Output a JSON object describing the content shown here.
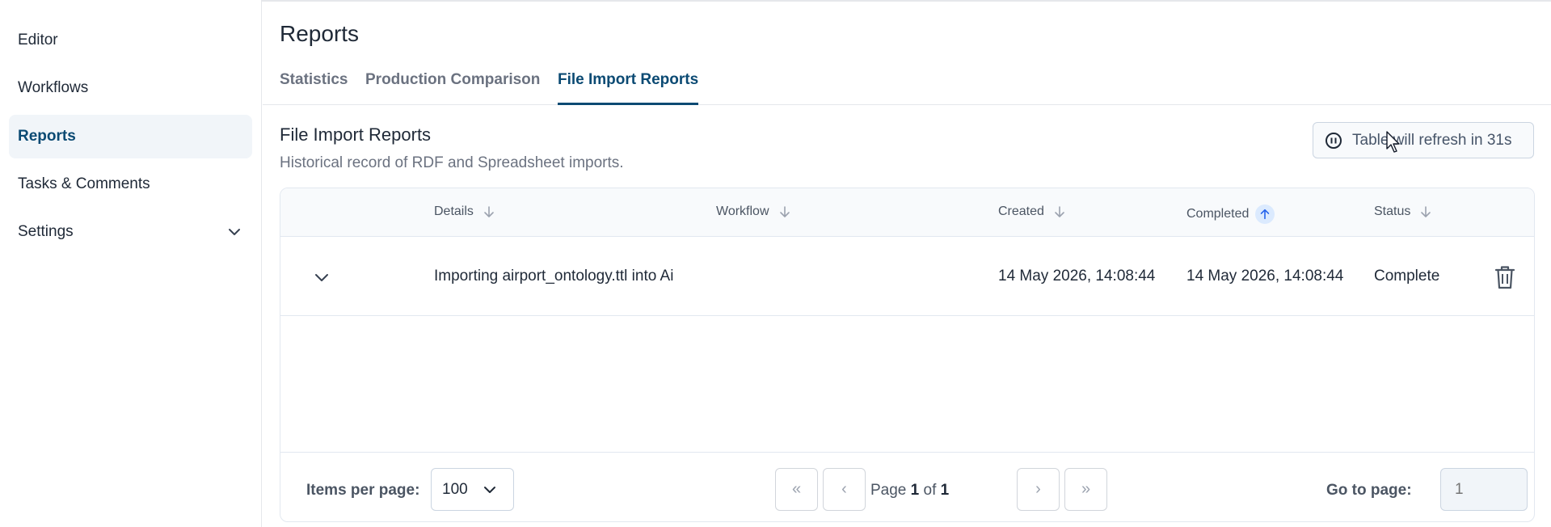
{
  "sidebar": {
    "items": [
      {
        "label": "Editor"
      },
      {
        "label": "Workflows"
      },
      {
        "label": "Reports"
      },
      {
        "label": "Tasks & Comments"
      },
      {
        "label": "Settings"
      }
    ]
  },
  "header": {
    "title": "Reports"
  },
  "tabs": [
    {
      "label": "Statistics"
    },
    {
      "label": "Production Comparison"
    },
    {
      "label": "File Import Reports"
    }
  ],
  "section": {
    "title": "File Import Reports",
    "subtitle": "Historical record of RDF and Spreadsheet imports.",
    "refresh_label": "Table will refresh in 31s"
  },
  "table": {
    "columns": [
      {
        "label": "Details"
      },
      {
        "label": "Workflow"
      },
      {
        "label": "Created"
      },
      {
        "label": "Completed"
      },
      {
        "label": "Status"
      }
    ],
    "rows": [
      {
        "details": "Importing airport_ontology.ttl into Ai",
        "workflow": "",
        "created": "14 May 2026, 14:08:44",
        "completed": "14 May 2026, 14:08:44",
        "status": "Complete"
      }
    ]
  },
  "pagination": {
    "items_per_page_label": "Items per page:",
    "items_per_page_value": "100",
    "page_prefix": "Page",
    "current_page": "1",
    "of_label": "of",
    "total_pages": "1",
    "first_symbol": "«",
    "prev_symbol": "‹",
    "next_symbol": "›",
    "last_symbol": "»",
    "goto_label": "Go to page:",
    "goto_placeholder": "1"
  },
  "colors": {
    "accent": "#0b4a73",
    "active_sort_bg": "#dbeafe"
  },
  "icons": [
    "chevron-down-icon",
    "pause-circle-icon",
    "sort-arrow-icon",
    "trash-icon",
    "cursor-icon"
  ]
}
